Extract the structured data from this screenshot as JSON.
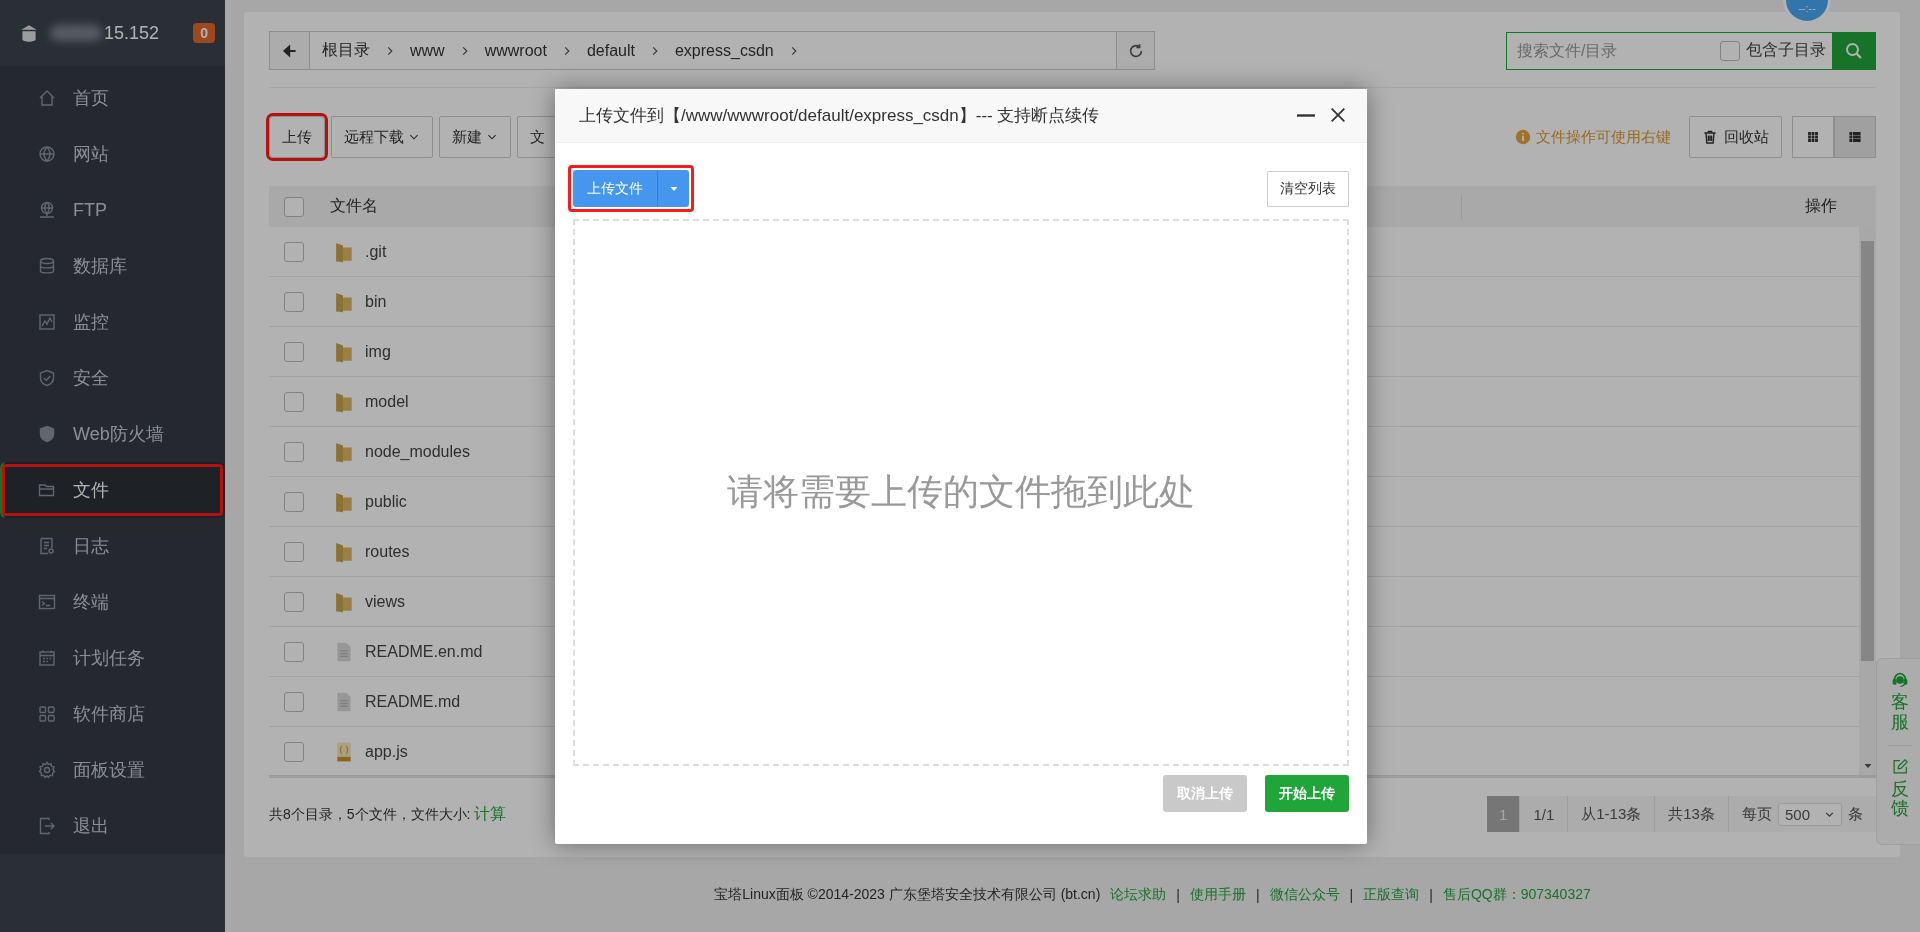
{
  "sidebar": {
    "server_label": "15.152",
    "badge": "0",
    "items": [
      {
        "label": "首页",
        "selected": false,
        "highlighted": false
      },
      {
        "label": "网站",
        "selected": false,
        "highlighted": false
      },
      {
        "label": "FTP",
        "selected": false,
        "highlighted": false
      },
      {
        "label": "数据库",
        "selected": false,
        "highlighted": false
      },
      {
        "label": "监控",
        "selected": false,
        "highlighted": false
      },
      {
        "label": "安全",
        "selected": false,
        "highlighted": false
      },
      {
        "label": "Web防火墙",
        "selected": false,
        "highlighted": false
      },
      {
        "label": "文件",
        "selected": true,
        "highlighted": true
      },
      {
        "label": "日志",
        "selected": false,
        "highlighted": false
      },
      {
        "label": "终端",
        "selected": false,
        "highlighted": false
      },
      {
        "label": "计划任务",
        "selected": false,
        "highlighted": false
      },
      {
        "label": "软件商店",
        "selected": false,
        "highlighted": false
      },
      {
        "label": "面板设置",
        "selected": false,
        "highlighted": false
      },
      {
        "label": "退出",
        "selected": false,
        "highlighted": false
      }
    ]
  },
  "clock": "--:--",
  "breadcrumb": [
    "根目录",
    "www",
    "wwwroot",
    "default",
    "express_csdn"
  ],
  "search": {
    "placeholder": "搜索文件/目录",
    "subdir_label": "包含子目录",
    "subdir_checked": false
  },
  "toolbar": {
    "buttons": [
      {
        "label": "上传",
        "dropdown": false,
        "highlighted": true
      },
      {
        "label": "远程下载",
        "dropdown": true,
        "highlighted": false
      },
      {
        "label": "新建",
        "dropdown": true,
        "highlighted": false
      },
      {
        "label": "文",
        "dropdown": false,
        "highlighted": false
      }
    ],
    "hint": "文件操作可使用右键",
    "recycle_label": "回收站",
    "views": [
      {
        "kind": "grid",
        "selected": false
      },
      {
        "kind": "list",
        "selected": true
      }
    ]
  },
  "table": {
    "all_checked": false,
    "columns": [
      "文件名",
      "操作"
    ],
    "rows": [
      {
        "name": ".git",
        "kind": "folder",
        "checked": false
      },
      {
        "name": "bin",
        "kind": "folder",
        "checked": false
      },
      {
        "name": "img",
        "kind": "folder",
        "checked": false
      },
      {
        "name": "model",
        "kind": "folder",
        "checked": false
      },
      {
        "name": "node_modules",
        "kind": "folder",
        "checked": false
      },
      {
        "name": "public",
        "kind": "folder",
        "checked": false
      },
      {
        "name": "routes",
        "kind": "folder",
        "checked": false
      },
      {
        "name": "views",
        "kind": "folder",
        "checked": false
      },
      {
        "name": "README.en.md",
        "kind": "file",
        "checked": false
      },
      {
        "name": "README.md",
        "kind": "file",
        "checked": false
      },
      {
        "name": "app.js",
        "kind": "script",
        "checked": false
      }
    ]
  },
  "summary": {
    "text": "共8个目录，5个文件，文件大小:",
    "link": "计算"
  },
  "pagination": {
    "current": "1",
    "pages": "1/1",
    "range": "从1-13条",
    "total": "共13条",
    "per_page_label": "每页",
    "per_page": "500",
    "unit": "条"
  },
  "modal": {
    "title": "上传文件到【/www/wwwroot/default/express_csdn】--- 支持断点续传",
    "upload_button": "上传文件",
    "upload_highlighted": true,
    "clear_button": "清空列表",
    "drop_text": "请将需要上传的文件拖到此处",
    "cancel_button": "取消上传",
    "cancel_disabled": true,
    "start_button": "开始上传"
  },
  "float_panel": [
    "客服",
    "反馈"
  ],
  "footer": {
    "separator": "|",
    "text": "宝塔Linux面板 ©2014-2023 广东堡塔安全技术有限公司 (bt.cn)",
    "links": [
      "论坛求助",
      "使用手册",
      "微信公众号",
      "正版查询",
      "售后QQ群：907340327"
    ]
  }
}
